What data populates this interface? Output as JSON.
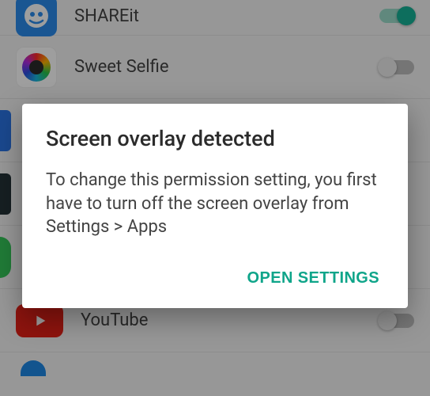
{
  "apps": {
    "shareit": {
      "label": "SHAREit",
      "toggle": "on"
    },
    "sweet": {
      "label": "Sweet Selfie",
      "toggle": "off"
    },
    "youtube": {
      "label": "YouTube",
      "toggle": "off"
    }
  },
  "dialog": {
    "title": "Screen overlay detected",
    "body": "To change this permission setting, you first have to turn off the screen overlay from Settings > Apps",
    "action_label": "OPEN SETTINGS"
  },
  "colors": {
    "accent": "#0fa58a"
  }
}
